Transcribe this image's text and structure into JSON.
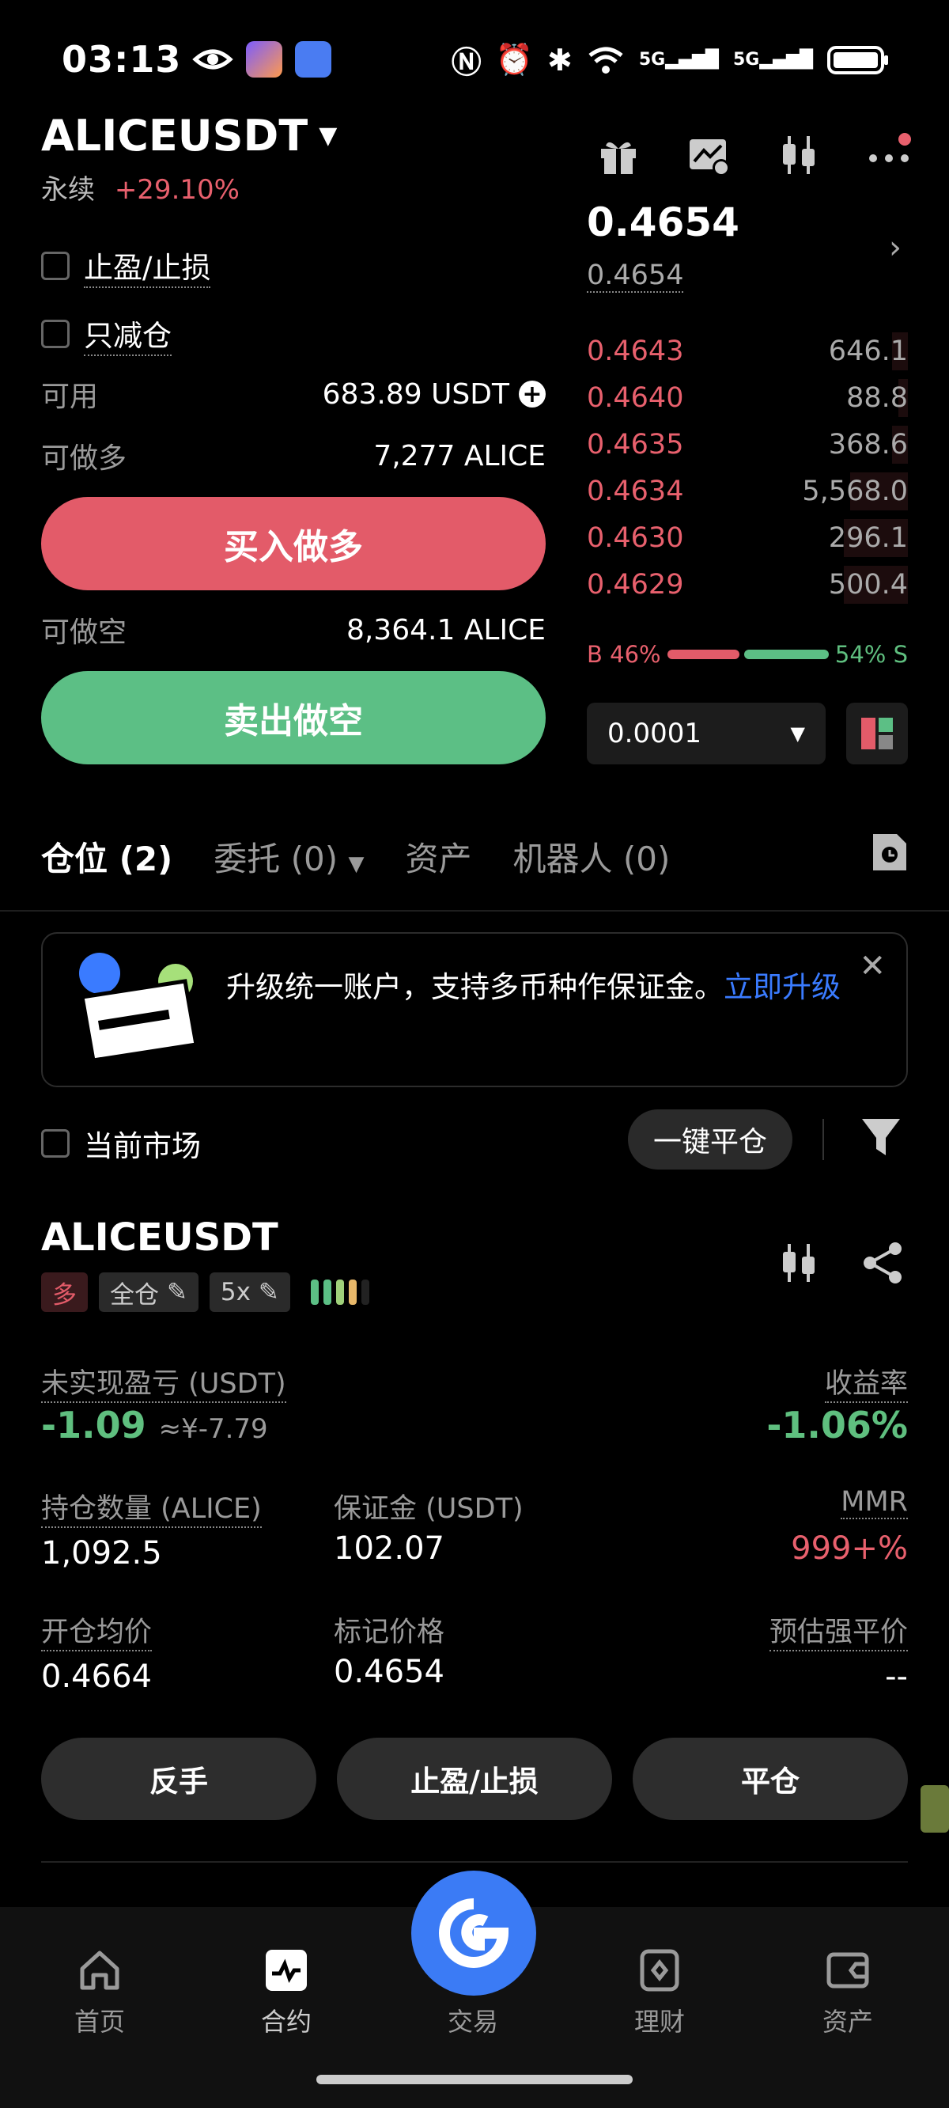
{
  "status_bar": {
    "time": "03:13",
    "network_a": "5G",
    "network_b": "5G"
  },
  "header": {
    "symbol": "ALICEUSDT",
    "type_label": "永续",
    "change": "+29.10%"
  },
  "order_form": {
    "tp_sl_label": "止盈/止损",
    "reduce_only_label": "只减仓",
    "available_label": "可用",
    "available_value": "683.89 USDT",
    "can_long_label": "可做多",
    "can_long_value": "7,277 ALICE",
    "buy_long_button": "买入做多",
    "can_short_label": "可做空",
    "can_short_value": "8,364.1 ALICE",
    "sell_short_button": "卖出做空"
  },
  "orderbook": {
    "last_price": "0.4654",
    "mark_price": "0.4654",
    "asks": [
      {
        "price": "0.4643",
        "qty": "646.1",
        "depth": 0.05
      },
      {
        "price": "0.4640",
        "qty": "88.8",
        "depth": 0.03
      },
      {
        "price": "0.4635",
        "qty": "368.6",
        "depth": 0.05
      },
      {
        "price": "0.4634",
        "qty": "5,568.0",
        "depth": 0.18
      },
      {
        "price": "0.4630",
        "qty": "296.1",
        "depth": 0.2
      },
      {
        "price": "0.4629",
        "qty": "500.4",
        "depth": 0.2
      }
    ],
    "buy_ratio": "B 46%",
    "sell_ratio": "54% S",
    "buy_pct": 46,
    "tick_size": "0.0001"
  },
  "tabs": [
    {
      "label": "仓位 (2)"
    },
    {
      "label": "委托 (0)"
    },
    {
      "label": "资产"
    },
    {
      "label": "机器人 (0)"
    }
  ],
  "banner": {
    "text": "升级统一账户，支持多币种作保证金。",
    "link": "立即升级"
  },
  "filters": {
    "current_market_label": "当前市场",
    "close_all_button": "一键平仓"
  },
  "position": {
    "symbol": "ALICEUSDT",
    "side_tag": "多",
    "margin_mode": "全仓",
    "leverage": "5x",
    "pnl_label": "未实现盈亏 (USDT)",
    "pnl_value": "-1.09",
    "pnl_cny": "≈¥-7.79",
    "roe_label": "收益率",
    "roe_value": "-1.06%",
    "qty_label": "持仓数量 (ALICE)",
    "qty_value": "1,092.5",
    "margin_label": "保证金 (USDT)",
    "margin_value": "102.07",
    "mmr_label": "MMR",
    "mmr_value": "999+%",
    "entry_label": "开仓均价",
    "entry_value": "0.4664",
    "mark_label": "标记价格",
    "mark_value": "0.4654",
    "liq_label": "预估强平价",
    "liq_value": "--",
    "reverse_button": "反手",
    "tpsl_button": "止盈/止损",
    "close_button": "平仓"
  },
  "bottom_nav": [
    {
      "label": "首页"
    },
    {
      "label": "合约"
    },
    {
      "label": "交易"
    },
    {
      "label": "理财"
    },
    {
      "label": "资产"
    }
  ]
}
